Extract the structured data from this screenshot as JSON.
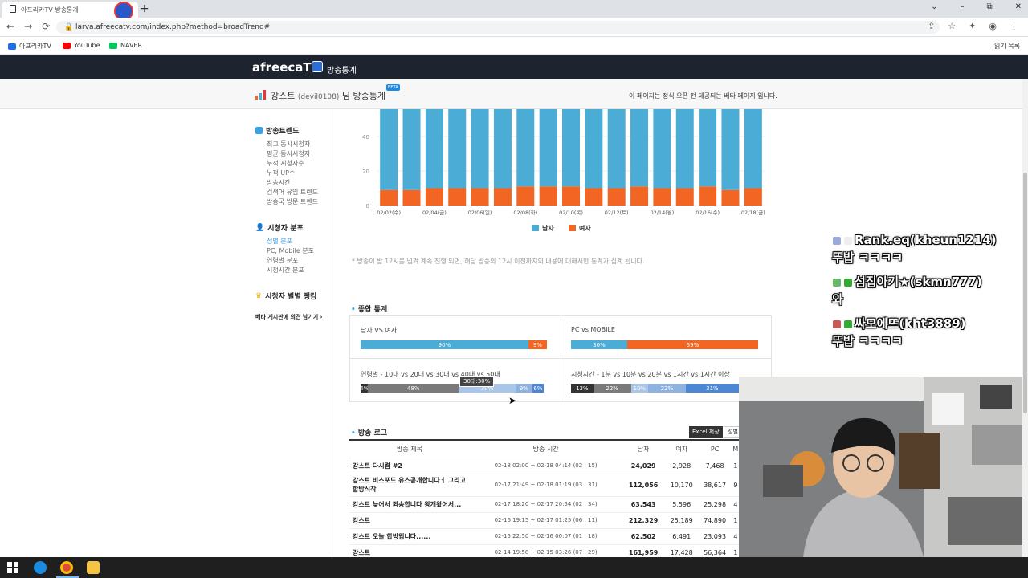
{
  "browser": {
    "tab_title": "아프리카TV 방송통계",
    "url": "larva.afreecatv.com/index.php?method=broadTrend#",
    "window_controls": [
      "⌄",
      "–",
      "⧉",
      "✕"
    ],
    "new_tab": "+",
    "nav": [
      "←",
      "→",
      "⟳"
    ],
    "tools": [
      "⇪",
      "☆",
      "✦",
      "◉",
      "⋮"
    ]
  },
  "bookmarks": {
    "items": [
      "아프리카TV",
      "YouTube",
      "NAVER"
    ],
    "reading_list": "읽기 목록",
    "colors": [
      "#1b6fe0",
      "#ff0000",
      "#03c75a"
    ]
  },
  "site": {
    "logo": "afreecaTV",
    "section": "방송통계",
    "streamer": "강스트",
    "streamer_id": "(devil0108)",
    "title_suffix": "님 방송통계",
    "beta": "BETA",
    "notice": "이 페이지는 정식 오픈 전 제공되는 베타 페이지 입니다."
  },
  "sidebar": {
    "trend_header": "방송트렌드",
    "trend_items": [
      "최고 동시시청자",
      "평균 동시시청자",
      "누적 시청자수",
      "누적 UP수",
      "방송시간",
      "검색어 유입 트렌드",
      "방송국 방문 트렌드"
    ],
    "viewer_header": "시청자 분포",
    "viewer_items": [
      "성별 분포",
      "PC, Mobile 분포",
      "연령별 분포",
      "시청시간 분포"
    ],
    "ranking_header": "시청자 별별 랭킹",
    "feedback": "베타 게시판에 의견 남기기 ›"
  },
  "chart_data": {
    "type": "bar",
    "stacked": true,
    "categories": [
      "02/02(수)",
      "",
      "02/04(금)",
      "",
      "02/06(일)",
      "",
      "02/08(화)",
      "",
      "02/10(목)",
      "",
      "02/12(토)",
      "",
      "02/14(월)",
      "",
      "02/16(수)",
      "",
      "02/18(금)"
    ],
    "series": [
      {
        "name": "남자",
        "color": "#4bacd6",
        "values": [
          91,
          91,
          90,
          90,
          90,
          90,
          89,
          89,
          89,
          90,
          90,
          89,
          90,
          90,
          89,
          91,
          90
        ]
      },
      {
        "name": "여자",
        "color": "#f26522",
        "values": [
          9,
          9,
          10,
          10,
          10,
          10,
          11,
          11,
          11,
          10,
          10,
          11,
          10,
          10,
          11,
          9,
          10
        ]
      }
    ],
    "ylim": [
      0,
      100
    ],
    "yticks": [
      "0",
      "20",
      "40"
    ],
    "legend_position": "bottom"
  },
  "footnote": "* 방송이 밤 12시를 넘겨 계속 진행 되면, 해당 방송의 12시 이전까지의 내용에 대해서만 통계가 집계 됩니다.",
  "summary": {
    "title": "종합 통계",
    "gender": {
      "label": "남자 VS 여자",
      "segments": [
        {
          "text": "90%",
          "value": 90,
          "color": "#4bacd6"
        },
        {
          "text": "9%",
          "value": 10,
          "color": "#f26522"
        }
      ]
    },
    "device": {
      "label": "PC vs MOBILE",
      "segments": [
        {
          "text": "30%",
          "value": 30,
          "color": "#4bacd6"
        },
        {
          "text": "69%",
          "value": 70,
          "color": "#f26522"
        }
      ]
    },
    "age": {
      "label": "연령별 - 10대 vs 20대 vs 30대 vs 40대 vs 50대",
      "tooltip": "30대:30%",
      "segments": [
        {
          "text": "4%",
          "value": 4,
          "color": "#333333"
        },
        {
          "text": "48%",
          "value": 48,
          "color": "#7a7a7a"
        },
        {
          "text": "30%",
          "value": 30,
          "color": "#a9c6e8"
        },
        {
          "text": "9%",
          "value": 9,
          "color": "#8fb3e0"
        },
        {
          "text": "6%",
          "value": 6,
          "color": "#4e86d6"
        }
      ]
    },
    "watch": {
      "label": "시청시간 - 1분 vs 10분 vs 20분 vs 1시간 vs 1시간 이상",
      "segments": [
        {
          "text": "13%",
          "value": 13,
          "color": "#333333"
        },
        {
          "text": "22%",
          "value": 22,
          "color": "#7a7a7a"
        },
        {
          "text": "10%",
          "value": 10,
          "color": "#a9c6e8"
        },
        {
          "text": "22%",
          "value": 22,
          "color": "#8fb3e0"
        },
        {
          "text": "31%",
          "value": 31,
          "color": "#4e86d6"
        }
      ]
    }
  },
  "log": {
    "title": "방송 로그",
    "excel": "Excel 저장",
    "filter": "성별",
    "columns": [
      "방송 제목",
      "방송 시간",
      "남자",
      "여자",
      "PC",
      "M"
    ],
    "rows": [
      {
        "title": "강스트 다시켬 #2",
        "time": "02-18 02:00 ~ 02-18 04:14 (02 : 15)",
        "male": "24,029",
        "female": "2,928",
        "pc": "7,468",
        "m": "1"
      },
      {
        "title": "강스트 비스포드 유스공개합니다ㅓ 그리고 합방식작",
        "time": "02-17 21:49 ~ 02-18 01:19 (03 : 31)",
        "male": "112,056",
        "female": "10,170",
        "pc": "38,617",
        "m": "9"
      },
      {
        "title": "강스트 늦어서 죄송합니다 왕개왔어서...",
        "time": "02-17 18:20 ~ 02-17 20:54 (02 : 34)",
        "male": "63,543",
        "female": "5,596",
        "pc": "25,298",
        "m": "4"
      },
      {
        "title": "강스트",
        "time": "02-16 19:15 ~ 02-17 01:25 (06 : 11)",
        "male": "212,329",
        "female": "25,189",
        "pc": "74,890",
        "m": "1"
      },
      {
        "title": "강스트 오늘 합방입니다......",
        "time": "02-15 22:50 ~ 02-16 00:07 (01 : 18)",
        "male": "62,502",
        "female": "6,491",
        "pc": "23,093",
        "m": "4"
      },
      {
        "title": "강스트",
        "time": "02-14 19:58 ~ 02-15 03:26 (07 : 29)",
        "male": "161,959",
        "female": "17,428",
        "pc": "56,364",
        "m": "1"
      }
    ]
  },
  "chat": [
    {
      "text": "Rank.eq(kheun1214)",
      "msg": "뚜밥 ㅋㅋㅋㅋ"
    },
    {
      "text": "섬집아기★(skmn777)",
      "msg": "와"
    },
    {
      "text": "싸모에뜨(kht3889)",
      "msg": "뚜밥 ㅋㅋㅋㅋ"
    }
  ]
}
